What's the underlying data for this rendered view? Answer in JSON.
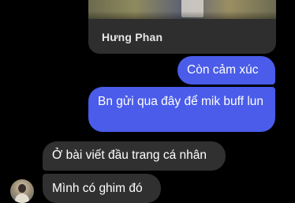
{
  "shared_post": {
    "name": "Hưng Phan"
  },
  "messages": [
    {
      "direction": "sent",
      "text": "Còn  cảm xúc"
    },
    {
      "direction": "sent",
      "text": "Bn gửi qua đây để mik buff lun"
    },
    {
      "direction": "received",
      "text": "Ở bài viết đầu trang cá nhân"
    },
    {
      "direction": "received",
      "text": "Mình có ghim đó"
    }
  ],
  "colors": {
    "background": "#000000",
    "sent_bubble": "#4a5ce9",
    "received_bubble": "#303030",
    "text": "#ffffff"
  }
}
